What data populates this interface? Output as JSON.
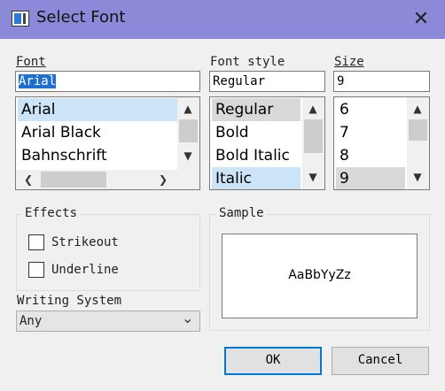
{
  "window": {
    "title": "Select Font",
    "close_glyph": "✕"
  },
  "font": {
    "label": "Font",
    "value": "Arial",
    "items": [
      "Arial",
      "Arial Black",
      "Bahnschrift"
    ]
  },
  "style": {
    "label": "Font style",
    "value": "Regular",
    "items": [
      "Regular",
      "Bold",
      "Bold Italic",
      "Italic"
    ]
  },
  "size": {
    "label": "Size",
    "value": "9",
    "items": [
      "6",
      "7",
      "8",
      "9"
    ]
  },
  "effects": {
    "label": "Effects",
    "strikeout": "Strikeout",
    "underline": "Underline"
  },
  "writing_system": {
    "label": "Writing System",
    "value": "Any"
  },
  "sample": {
    "label": "Sample",
    "text": "AaBbYyZz"
  },
  "buttons": {
    "ok": "OK",
    "cancel": "Cancel"
  },
  "icons": {
    "up": "▲",
    "down": "▼",
    "left": "❮",
    "right": "❯",
    "combo": "⌄"
  },
  "colors": {
    "titlebar": "#8c8ad8",
    "selection": "#1e6fd0",
    "highlight": "#cce4f7",
    "default_border": "#0078d7"
  }
}
